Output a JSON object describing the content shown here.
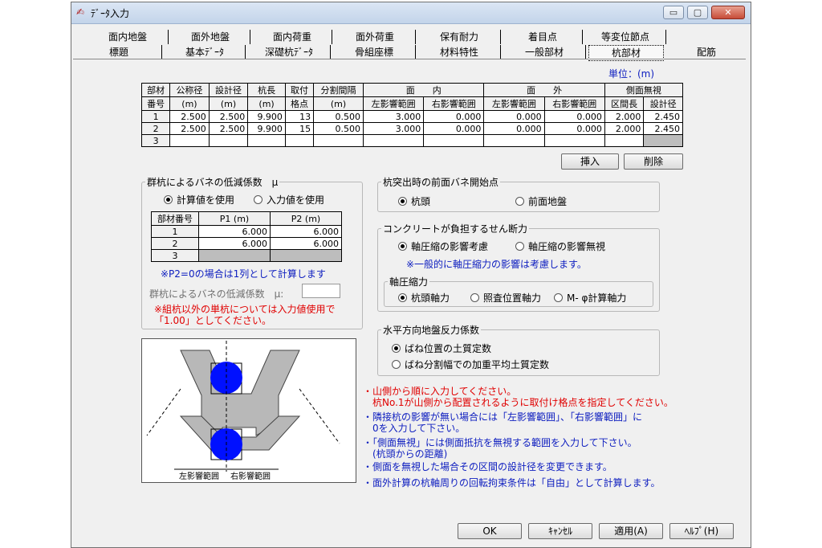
{
  "window": {
    "title": "ﾃﾞｰﾀ入力",
    "controls": {
      "minimize": "▭",
      "maximize": "▢",
      "close": "✕"
    }
  },
  "tabs": {
    "row1": [
      "面内地盤",
      "面外地盤",
      "面内荷重",
      "面外荷重",
      "保有耐力",
      "着目点",
      "等変位節点"
    ],
    "row2": [
      "標題",
      "基本ﾃﾞｰﾀ",
      "深礎杭ﾃﾞｰﾀ",
      "骨組座標",
      "材料特性",
      "一般部材",
      "杭部材",
      "配筋"
    ],
    "selected": "杭部材"
  },
  "unit_label": "単位：(m)",
  "member_table": {
    "header1": [
      "部材",
      "公称径",
      "設計径",
      "杭長",
      "取付",
      "分割間隔",
      "面　　内",
      "面　　外",
      "側面無視"
    ],
    "header2": [
      "番号",
      "(m)",
      "(m)",
      "(m)",
      "格点",
      "(m)",
      "左影響範囲",
      "右影響範囲",
      "左影響範囲",
      "右影響範囲",
      "区間長",
      "設計径"
    ],
    "rows": [
      [
        "1",
        "2.500",
        "2.500",
        "9.900",
        "13",
        "0.500",
        "3.000",
        "0.000",
        "0.000",
        "0.000",
        "2.000",
        "2.450"
      ],
      [
        "2",
        "2.500",
        "2.500",
        "9.900",
        "15",
        "0.500",
        "3.000",
        "0.000",
        "0.000",
        "0.000",
        "2.000",
        "2.450"
      ],
      [
        "3",
        "",
        "",
        "",
        "",
        "",
        "",
        "",
        "",
        "",
        "",
        ""
      ]
    ]
  },
  "buttons": {
    "insert": "挿入",
    "delete": "削除",
    "ok": "OK",
    "cancel": "ｷｬﾝｾﾙ",
    "apply": "適用(A)",
    "help": "ﾍﾙﾌﾟ(H)"
  },
  "group_reduction": {
    "legend": "群杭によるバネの低減係数　μ",
    "opt_calc": "計算値を使用",
    "opt_input": "入力値を使用",
    "table_header": [
      "部材番号",
      "P1 (m)",
      "P2 (m)"
    ],
    "rows": [
      [
        "1",
        "6.000",
        "6.000"
      ],
      [
        "2",
        "6.000",
        "6.000"
      ],
      [
        "3",
        "",
        ""
      ]
    ],
    "note": "※P2=0の場合は1列として計算します",
    "mu_label": "群杭によるバネの低減係数　μ:",
    "mu_value": "",
    "warn1": "※組杭以外の単杭については入力値使用で",
    "warn2": "「1.00」としてください。"
  },
  "front_spring": {
    "legend": "杭突出時の前面バネ開始点",
    "opt1": "杭頭",
    "opt2": "前面地盤"
  },
  "shear": {
    "legend": "コンクリートが負担するせん断力",
    "opt1": "軸圧縮の影響考慮",
    "opt2": "軸圧縮の影響無視",
    "note": "※一般的に軸圧縮力の影響は考慮します。",
    "sub_legend": "軸圧縮力",
    "sub1": "杭頭軸力",
    "sub2": "照査位置軸力",
    "sub3": "M- φ計算軸力"
  },
  "horizontal": {
    "legend": "水平方向地盤反力係数",
    "opt1": "ばね位置の土質定数",
    "opt2": "ばね分割幅での加重平均土質定数"
  },
  "diagram": {
    "label_left": "左影響範囲",
    "label_right": "右影響範囲"
  },
  "notes": [
    {
      "text": "・山側から順に入力してください。",
      "color": "#e00000"
    },
    {
      "text": "　杭No.1が山側から配置されるように取付け格点を指定してください。",
      "color": "#e00000"
    },
    {
      "text": "・隣接杭の影響が無い場合には「左影響範囲」、「右影響範囲」に",
      "color": "#1020c0"
    },
    {
      "text": "　0を入力して下さい。",
      "color": "#1020c0"
    },
    {
      "text": "・「側面無視」には側面抵抗を無視する範囲を入力して下さい。",
      "color": "#1020c0"
    },
    {
      "text": "　(杭頭からの距離)",
      "color": "#1020c0"
    },
    {
      "text": "・側面を無視した場合その区間の設計径を変更できます。",
      "color": "#1020c0"
    },
    {
      "text": "・面外計算の杭軸周りの回転拘束条件は「自由」として計算します。",
      "color": "#1020c0"
    }
  ]
}
